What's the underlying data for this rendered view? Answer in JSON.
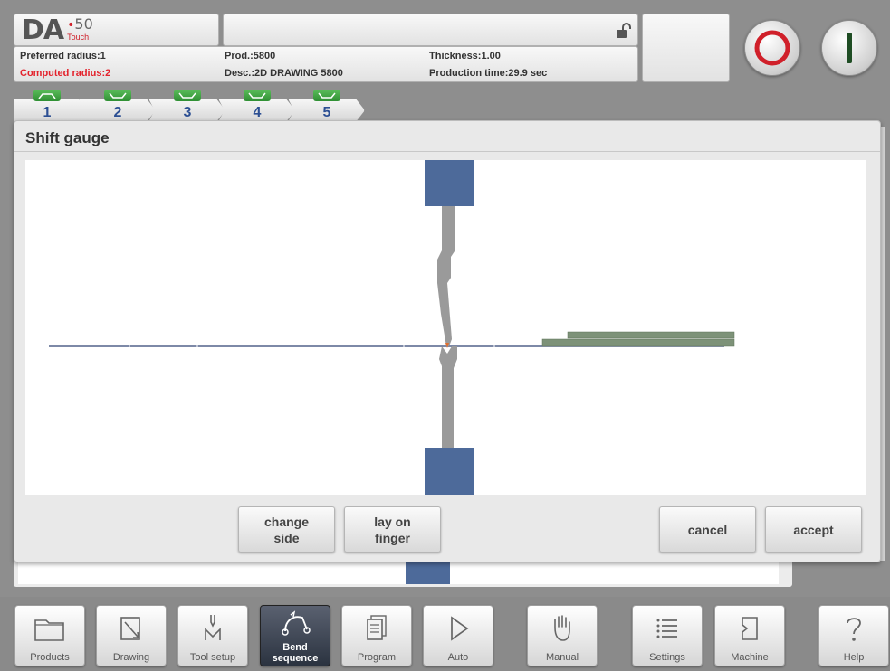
{
  "logo": {
    "brand": "DA",
    "model": "50",
    "edition": "Touch"
  },
  "product_info": {
    "preferred_radius": "Preferred radius:1",
    "computed_radius": "Computed radius:2",
    "prod": "Prod.:5800",
    "desc": "Desc.:2D DRAWING 5800",
    "thickness": "Thickness:1.00",
    "production_time": "Production time:29.9 sec"
  },
  "controls": {
    "lock_state": "unlocked",
    "stop_icon": "stop-icon",
    "start_icon": "start-icon"
  },
  "steps": [
    {
      "label": "1",
      "icon": "bend-up",
      "active": true
    },
    {
      "label": "2",
      "icon": "bend-down",
      "active": false
    },
    {
      "label": "3",
      "icon": "bend-down",
      "active": false
    },
    {
      "label": "4",
      "icon": "bend-down",
      "active": false
    },
    {
      "label": "5",
      "icon": "bend-down",
      "active": false
    }
  ],
  "dialog": {
    "title": "Shift gauge",
    "buttons": {
      "change_side": "change\nside",
      "lay_on_finger": "lay on\nfinger",
      "cancel": "cancel",
      "accept": "accept"
    }
  },
  "colors": {
    "tool_clamp": "#4d6a9a",
    "tool": "#9a9a9a",
    "sheet_line": "#52628a",
    "backgauge": "#7d9278",
    "stop_ring": "#d0202a",
    "start_bar": "#1f4d24"
  },
  "nav": [
    {
      "label": "Products",
      "icon": "folder-icon"
    },
    {
      "label": "Drawing",
      "icon": "pencil-icon"
    },
    {
      "label": "Tool setup",
      "icon": "tool-icon"
    },
    {
      "label": "Bend\nsequence",
      "icon": "bend-sequence-icon",
      "active": true
    },
    {
      "label": "Program",
      "icon": "document-icon"
    },
    {
      "label": "Auto",
      "icon": "play-icon"
    },
    {
      "label": "Manual",
      "icon": "hand-icon"
    },
    {
      "label": "Settings",
      "icon": "list-icon"
    },
    {
      "label": "Machine",
      "icon": "machine-icon"
    },
    {
      "label": "Help",
      "icon": "question-icon"
    }
  ]
}
